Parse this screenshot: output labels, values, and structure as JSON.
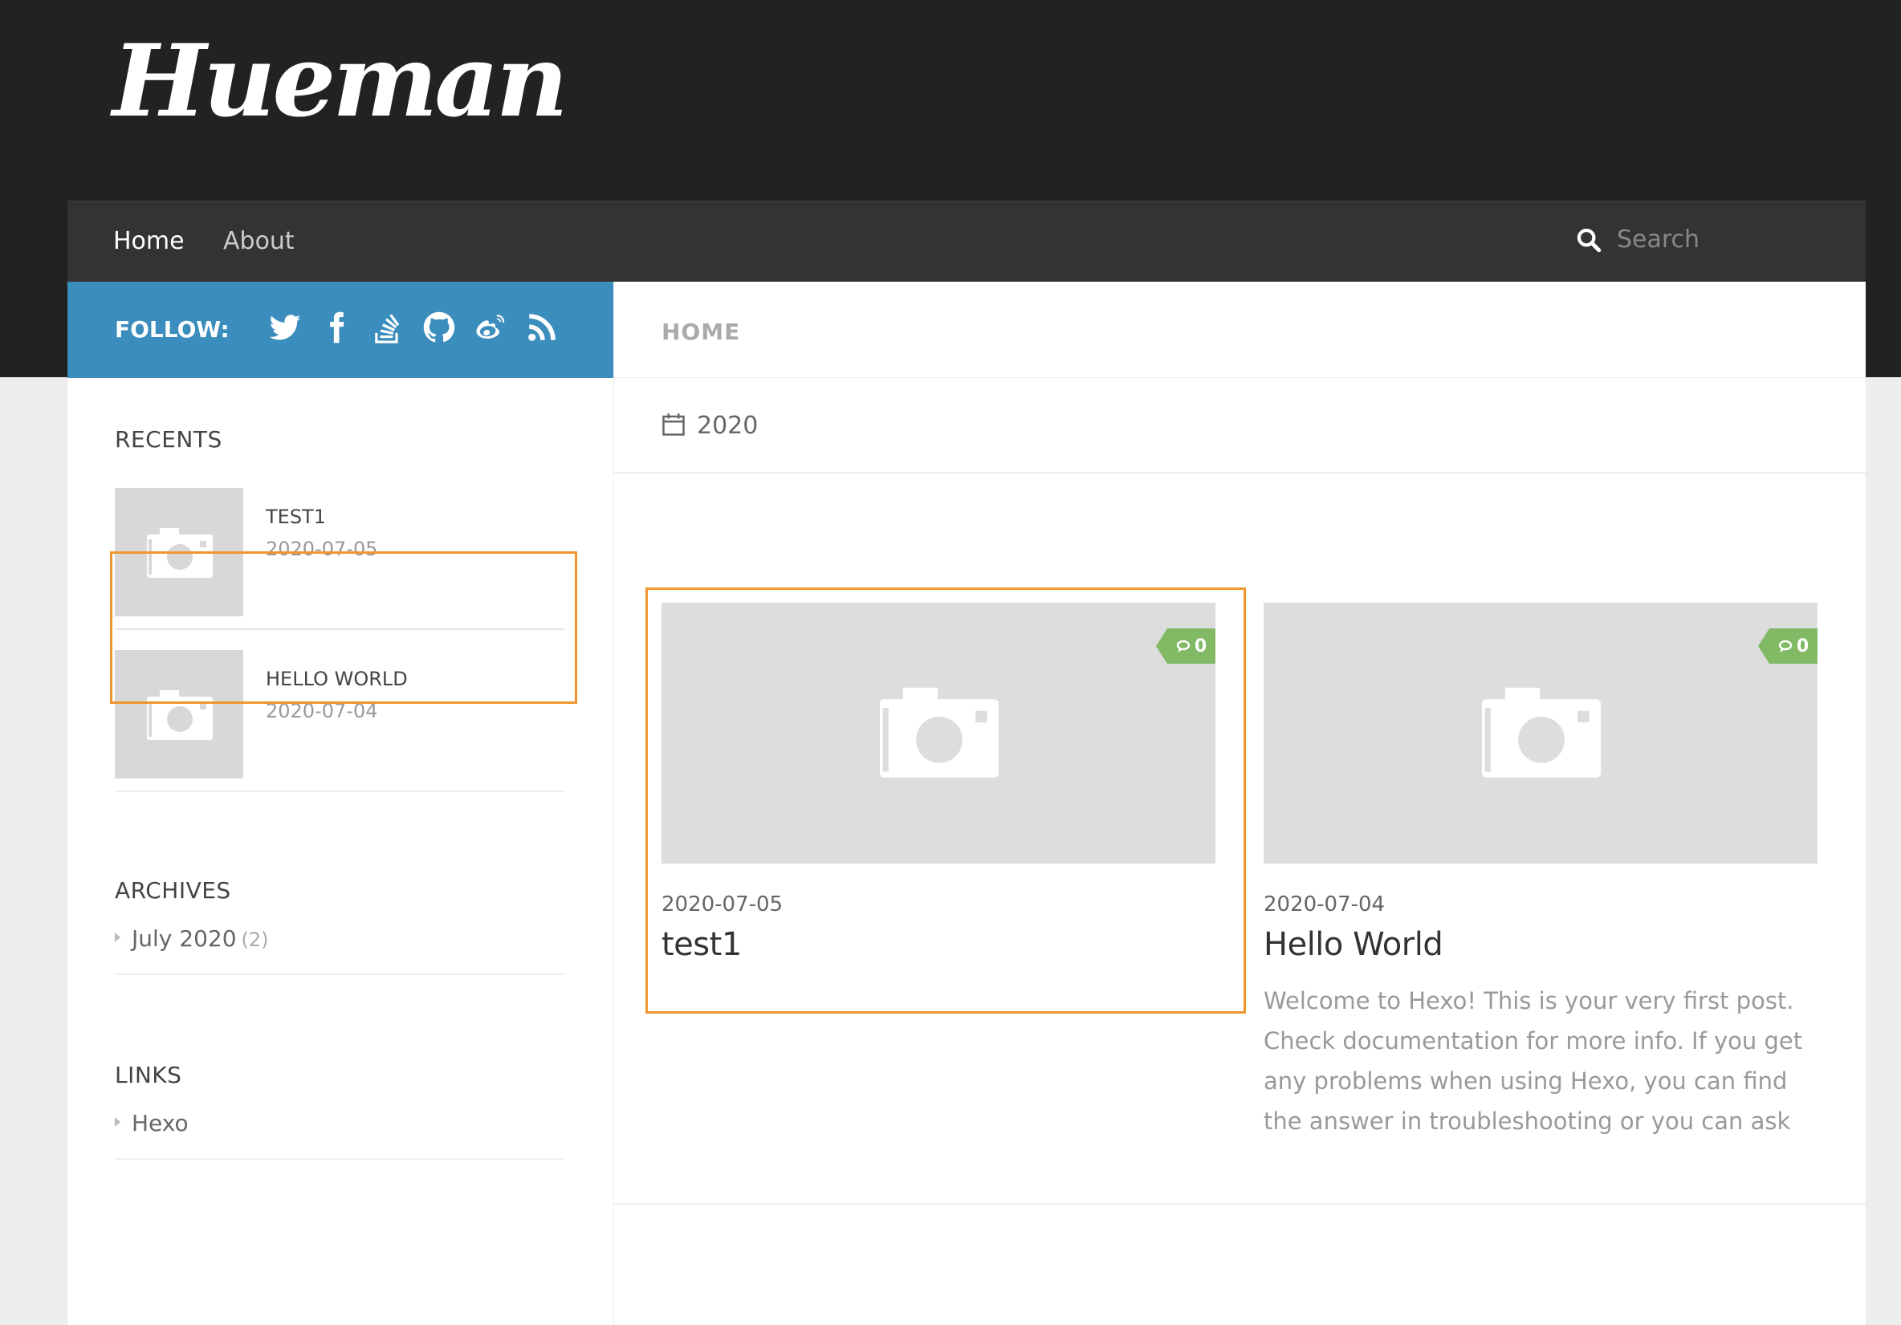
{
  "site": {
    "logo": "Hueman"
  },
  "nav": {
    "items": [
      {
        "label": "Home",
        "active": true
      },
      {
        "label": "About",
        "active": false
      }
    ],
    "search": {
      "placeholder": "Search"
    }
  },
  "follow": {
    "label": "FOLLOW:",
    "icons": [
      "twitter-icon",
      "facebook-icon",
      "stackoverflow-icon",
      "github-icon",
      "weibo-icon",
      "rss-icon"
    ],
    "color": "#3b8dbd"
  },
  "sidebar": {
    "recents": {
      "title": "RECENTS",
      "items": [
        {
          "title": "TEST1",
          "date": "2020-07-05"
        },
        {
          "title": "HELLO WORLD",
          "date": "2020-07-04"
        }
      ]
    },
    "archives": {
      "title": "ARCHIVES",
      "items": [
        {
          "label": "July 2020",
          "count": "(2)"
        }
      ]
    },
    "links": {
      "title": "LINKS",
      "items": [
        {
          "label": "Hexo"
        }
      ]
    }
  },
  "content": {
    "page_title": "HOME",
    "archive_year": "2020",
    "posts": [
      {
        "date": "2020-07-05",
        "title": "test1",
        "comments": "0",
        "excerpt": ""
      },
      {
        "date": "2020-07-04",
        "title": "Hello World",
        "comments": "0",
        "excerpt": "Welcome to Hexo! This is your very first post. Check documentation for more info. If you get any problems when using Hexo, you can find the answer in troubleshooting or you can ask me on"
      }
    ]
  },
  "colors": {
    "highlight": "#f0962f",
    "comment_badge": "#82b965",
    "header_bg": "#222222",
    "nav_bg": "#333333"
  }
}
